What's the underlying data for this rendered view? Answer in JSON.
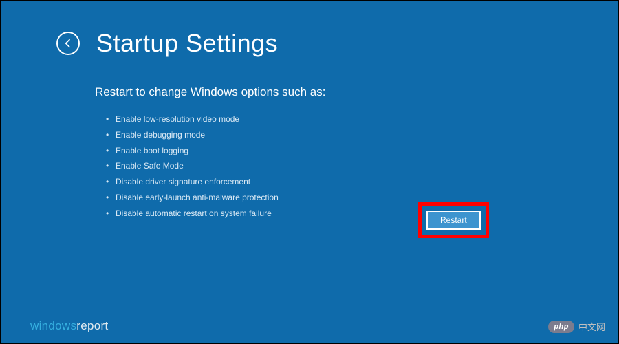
{
  "header": {
    "title": "Startup Settings"
  },
  "main": {
    "subtitle": "Restart to change Windows options such as:",
    "options": [
      "Enable low-resolution video mode",
      "Enable debugging mode",
      "Enable boot logging",
      "Enable Safe Mode",
      "Disable driver signature enforcement",
      "Disable early-launch anti-malware protection",
      "Disable automatic restart on system failure"
    ],
    "restart_label": "Restart"
  },
  "watermarks": {
    "left_part1": "windows",
    "left_part2": "report",
    "right_badge": "php",
    "right_text": "中文网"
  }
}
